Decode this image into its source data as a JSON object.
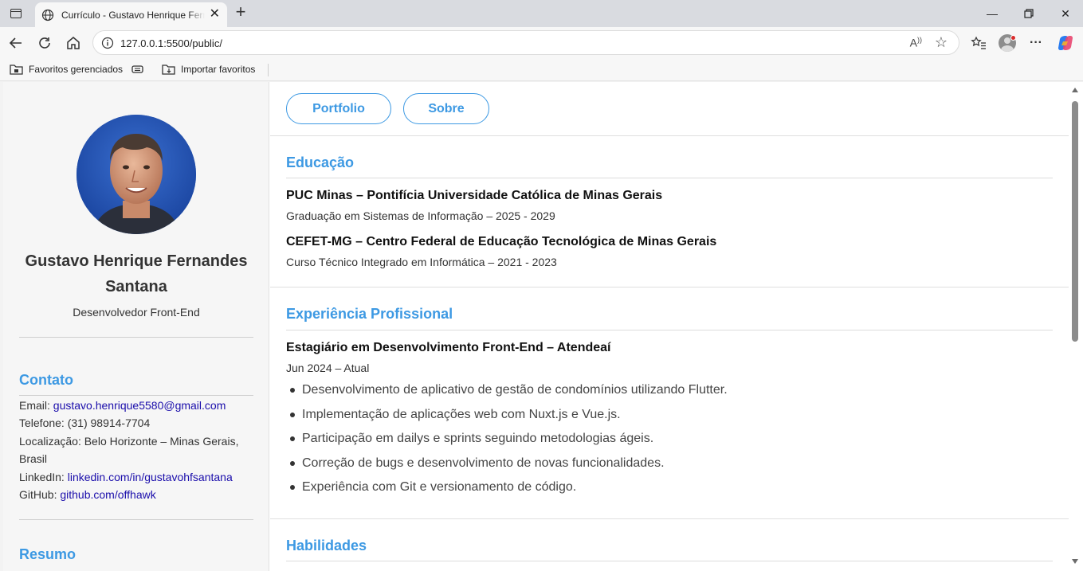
{
  "browser": {
    "tab_title": "Currículo - Gustavo Henrique Fernandes Santana",
    "url": "127.0.0.1:5500/public/",
    "favorites": [
      "Favoritos gerenciados",
      "Importar favoritos"
    ]
  },
  "sidebar": {
    "name": "Gustavo Henrique Fernandes Santana",
    "role": "Desenvolvedor Front-End",
    "contact": {
      "heading": "Contato",
      "email_label": "Email:",
      "email": "gustavo.henrique5580@gmail.com",
      "phone_label": "Telefone:",
      "phone": "(31) 98914-7704",
      "location_label": "Localização:",
      "location": "Belo Horizonte – Minas Gerais, Brasil",
      "linkedin_label": "LinkedIn:",
      "linkedin": "linkedin.com/in/gustavohfsantana",
      "github_label": "GitHub:",
      "github": "github.com/offhawk"
    },
    "summary_heading": "Resumo"
  },
  "main": {
    "nav": [
      "Portfolio",
      "Sobre"
    ],
    "education": {
      "heading": "Educação",
      "items": [
        {
          "title": "PUC Minas – Pontifícia Universidade Católica de Minas Gerais",
          "detail": "Graduação em Sistemas de Informação – 2025 - 2029"
        },
        {
          "title": "CEFET-MG – Centro Federal de Educação Tecnológica de Minas Gerais",
          "detail": "Curso Técnico Integrado em Informática – 2021 - 2023"
        }
      ]
    },
    "experience": {
      "heading": "Experiência Profissional",
      "title": "Estagiário em Desenvolvimento Front-End – Atendeaí",
      "period": "Jun 2024 – Atual",
      "bullets": [
        "Desenvolvimento de aplicativo de gestão de condomínios utilizando Flutter.",
        "Implementação de aplicações web com Nuxt.js e Vue.js.",
        "Participação em dailys e sprints seguindo metodologias ágeis.",
        "Correção de bugs e desenvolvimento de novas funcionalidades.",
        "Experiência com Git e versionamento de código."
      ]
    },
    "skills_heading": "Habilidades"
  },
  "colors": {
    "accent": "#3d99e3",
    "link": "#1a0dab",
    "sidebar_bg": "#f6f6f6"
  }
}
